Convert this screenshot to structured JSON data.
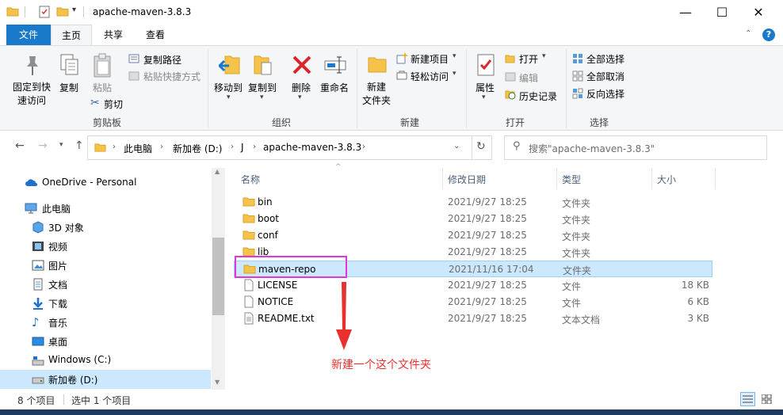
{
  "titlebar": {
    "title": "apache-maven-3.8.3",
    "minimize": "—",
    "maximize": "☐",
    "close": "✕"
  },
  "tabs": {
    "file": "文件",
    "home": "主页",
    "share": "共享",
    "view": "查看"
  },
  "ribbon": {
    "clipboard": {
      "pin_line1": "固定到快",
      "pin_line2": "速访问",
      "copy": "复制",
      "paste": "粘贴",
      "copy_path": "复制路径",
      "paste_shortcut": "粘贴快捷方式",
      "cut": "剪切",
      "label": "剪贴板"
    },
    "organize": {
      "move_to": "移动到",
      "copy_to": "复制到",
      "delete": "删除",
      "rename": "重命名",
      "label": "组织"
    },
    "new": {
      "new_folder_line1": "新建",
      "new_folder_line2": "文件夹",
      "new_item": "新建项目",
      "easy_access": "轻松访问",
      "label": "新建"
    },
    "open": {
      "properties": "属性",
      "open": "打开",
      "edit": "编辑",
      "history": "历史记录",
      "label": "打开"
    },
    "select": {
      "select_all": "全部选择",
      "select_none": "全部取消",
      "invert": "反向选择",
      "label": "选择"
    }
  },
  "address": {
    "crumbs": [
      "此电脑",
      "新加卷 (D:)",
      "J",
      "apache-maven-3.8.3"
    ],
    "search_placeholder": "搜索\"apache-maven-3.8.3\""
  },
  "nav": {
    "items": [
      {
        "label": "OneDrive - Personal",
        "icon": "onedrive-icon"
      },
      {
        "label": "此电脑",
        "icon": "computer-icon"
      },
      {
        "label": "3D 对象",
        "icon": "3d-objects-icon"
      },
      {
        "label": "视频",
        "icon": "videos-icon"
      },
      {
        "label": "图片",
        "icon": "pictures-icon"
      },
      {
        "label": "文档",
        "icon": "documents-icon"
      },
      {
        "label": "下载",
        "icon": "downloads-icon"
      },
      {
        "label": "音乐",
        "icon": "music-icon"
      },
      {
        "label": "桌面",
        "icon": "desktop-icon"
      },
      {
        "label": "Windows (C:)",
        "icon": "drive-icon"
      },
      {
        "label": "新加卷 (D:)",
        "icon": "drive-icon"
      }
    ]
  },
  "columns": {
    "name": "名称",
    "date": "修改日期",
    "type": "类型",
    "size": "大小"
  },
  "files": [
    {
      "name": "bin",
      "date": "2021/9/27 18:25",
      "type": "文件夹",
      "size": "",
      "icon": "folder-icon"
    },
    {
      "name": "boot",
      "date": "2021/9/27 18:25",
      "type": "文件夹",
      "size": "",
      "icon": "folder-icon"
    },
    {
      "name": "conf",
      "date": "2021/9/27 18:25",
      "type": "文件夹",
      "size": "",
      "icon": "folder-icon"
    },
    {
      "name": "lib",
      "date": "2021/9/27 18:25",
      "type": "文件夹",
      "size": "",
      "icon": "folder-icon"
    },
    {
      "name": "maven-repo",
      "date": "2021/11/16 17:04",
      "type": "文件夹",
      "size": "",
      "icon": "folder-icon"
    },
    {
      "name": "LICENSE",
      "date": "2021/9/27 18:25",
      "type": "文件",
      "size": "18 KB",
      "icon": "file-icon"
    },
    {
      "name": "NOTICE",
      "date": "2021/9/27 18:25",
      "type": "文件",
      "size": "6 KB",
      "icon": "file-icon"
    },
    {
      "name": "README.txt",
      "date": "2021/9/27 18:25",
      "type": "文本文档",
      "size": "3 KB",
      "icon": "text-file-icon"
    }
  ],
  "annotation": {
    "text": "新建一个这个文件夹",
    "color": "#e8312f",
    "highlight_color": "#e036d6"
  },
  "status": {
    "count": "8 个项目",
    "selected": "选中 1 个项目"
  },
  "colors": {
    "accent": "#1979ca",
    "selection": "#cce8ff",
    "folder": "#f5c34a"
  }
}
